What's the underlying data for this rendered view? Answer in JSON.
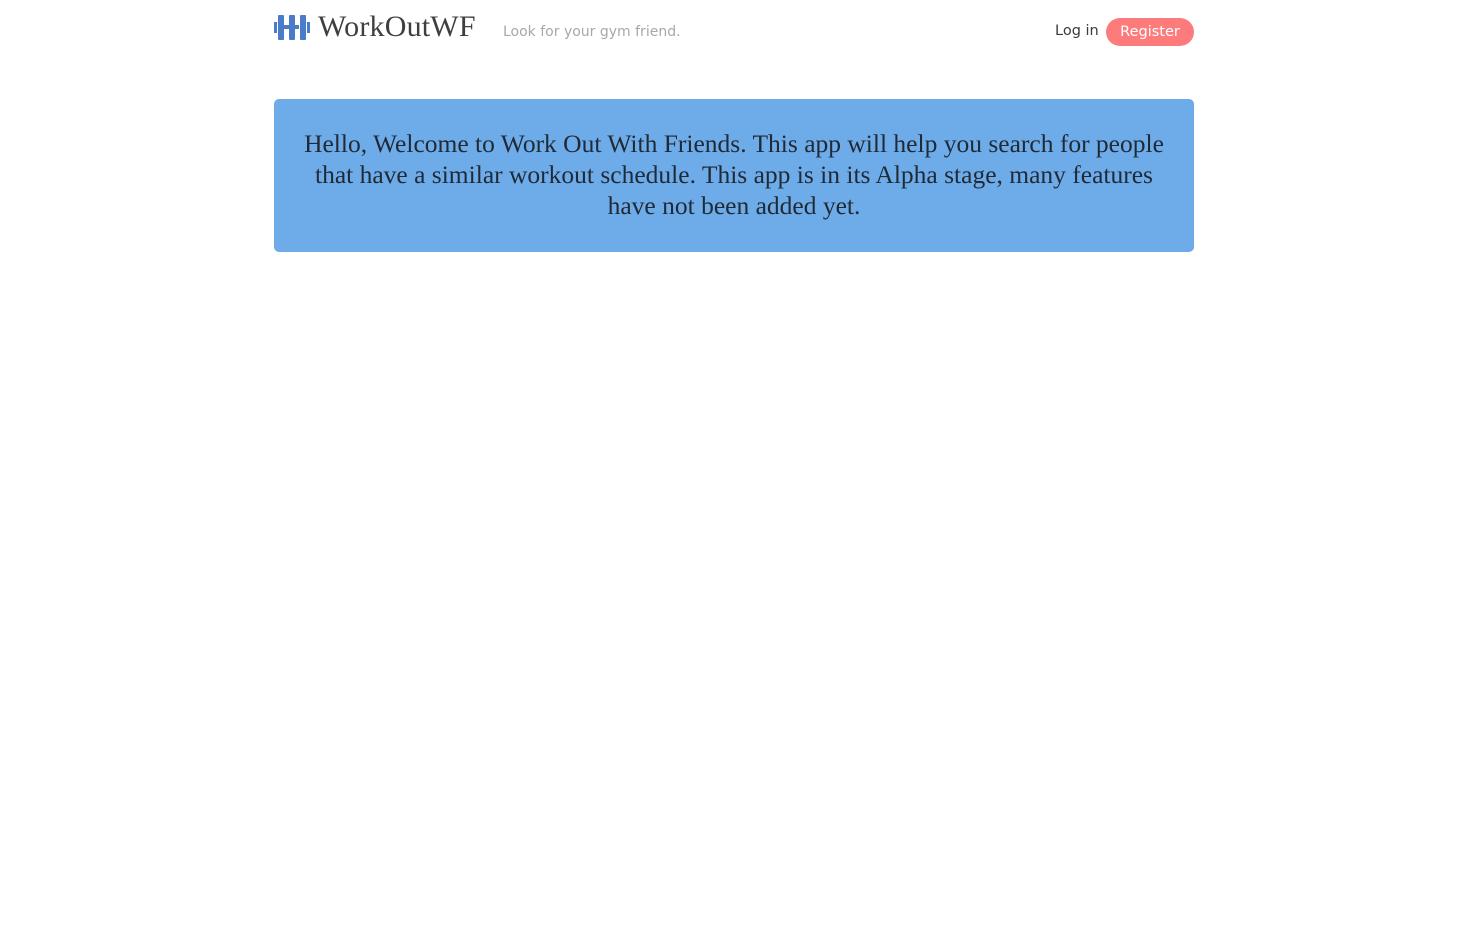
{
  "header": {
    "brand": {
      "title": "WorkOutWF",
      "tagline": "Look for your gym friend.",
      "icon": "dumbbell-icon",
      "icon_color": "#4a7cc9"
    },
    "nav": {
      "login_label": "Log in",
      "register_label": "Register"
    }
  },
  "main": {
    "welcome_message": "Hello, Welcome to Work Out With Friends. This app will help you search for people that have a similar workout schedule. This app is in its Alpha stage, many features have not been added yet."
  },
  "colors": {
    "primary": "#6eabe9",
    "accent": "#fd7b7b",
    "brand_icon": "#4a7cc9"
  }
}
